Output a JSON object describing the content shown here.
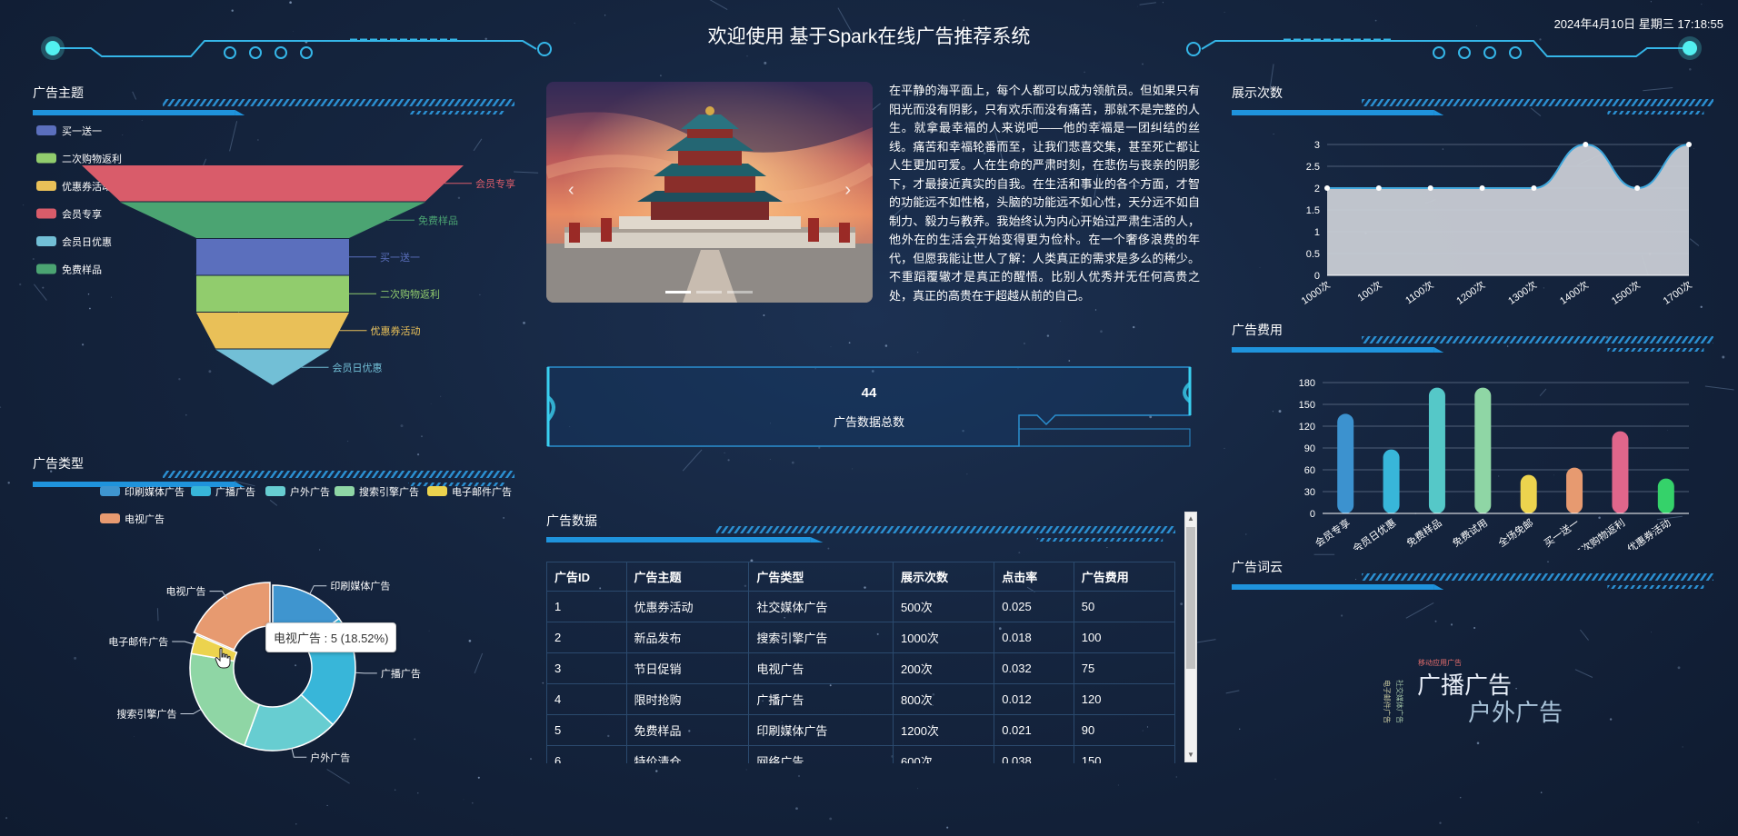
{
  "header": {
    "title": "欢迎使用 基于Spark在线广告推荐系统",
    "datetime": "2024年4月10日 星期三 17:18:55"
  },
  "panels": {
    "ad_theme": "广告主题",
    "ad_type": "广告类型",
    "impressions": "展示次数",
    "ad_cost": "广告费用",
    "ad_data": "广告数据",
    "word_cloud": "广告词云"
  },
  "carousel": {
    "prev_icon": "chevron-left-icon",
    "next_icon": "chevron-right-icon",
    "slide_count": 3,
    "active_index": 0
  },
  "article": {
    "text": "在平静的海平面上，每个人都可以成为领航员。但如果只有阳光而没有阴影，只有欢乐而没有痛苦，那就不是完整的人生。就拿最幸福的人来说吧——他的幸福是一团纠结的丝线。痛苦和幸福轮番而至，让我们悲喜交集，甚至死亡都让人生更加可爱。人在生命的严肃时刻，在悲伤与丧亲的阴影下，才最接近真实的自我。在生活和事业的各个方面，才智的功能远不如性格，头脑的功能远不如心性，天分远不如自制力、毅力与教养。我始终认为内心开始过严肃生活的人，他外在的生活会开始变得更为俭朴。在一个奢侈浪费的年代，但愿我能让世人了解：人类真正的需求是多么的稀少。不重蹈覆辙才是真正的醒悟。比别人优秀并无任何高贵之处，真正的高贵在于超越从前的自己。"
  },
  "stat": {
    "value": "44",
    "label": "广告数据总数"
  },
  "table": {
    "headers": [
      "广告ID",
      "广告主题",
      "广告类型",
      "展示次数",
      "点击率",
      "广告费用"
    ],
    "rows": [
      [
        "1",
        "优惠券活动",
        "社交媒体广告",
        "500次",
        "0.025",
        "50"
      ],
      [
        "2",
        "新品发布",
        "搜索引擎广告",
        "1000次",
        "0.018",
        "100"
      ],
      [
        "3",
        "节日促销",
        "电视广告",
        "200次",
        "0.032",
        "75"
      ],
      [
        "4",
        "限时抢购",
        "广播广告",
        "800次",
        "0.012",
        "120"
      ],
      [
        "5",
        "免费样品",
        "印刷媒体广告",
        "1200次",
        "0.021",
        "90"
      ],
      [
        "6",
        "特价清仓",
        "网络广告",
        "600次",
        "0.038",
        "150"
      ]
    ],
    "scroll_up_icon": "triangle-up-icon",
    "scroll_down_icon": "triangle-down-icon"
  },
  "pie_tooltip": "电视广告 : 5 (18.52%)",
  "word_cloud": {
    "words": [
      {
        "text": "广播广告",
        "color": "#e8eef8"
      },
      {
        "text": "户外广告",
        "color": "#a9c3d9"
      },
      {
        "text": "移动应用广告",
        "color": "#e06b6b"
      },
      {
        "text": "电子邮件广告",
        "color": "#c9c9a0"
      },
      {
        "text": "社交媒体广告",
        "color": "#9fc0a4"
      }
    ]
  },
  "chart_data": [
    {
      "type": "funnel",
      "title": "广告主题",
      "legend": [
        "买一送一",
        "二次购物返利",
        "优惠券活动",
        "会员专享",
        "会员日优惠",
        "免费样品"
      ],
      "legend_position": "top-left",
      "categories": [
        "会员专享",
        "免费样品",
        "买一送一",
        "二次购物返利",
        "优惠券活动",
        "会员日优惠"
      ],
      "values": [
        100,
        80,
        40,
        40,
        40,
        30
      ],
      "colors": [
        "#d95c6a",
        "#4ba472",
        "#5b6fbd",
        "#91cc6d",
        "#e9c058",
        "#72bfd6"
      ]
    },
    {
      "type": "pie",
      "title": "广告类型",
      "legend": [
        "印刷媒体广告",
        "广播广告",
        "户外广告",
        "搜索引擎广告",
        "电子邮件广告",
        "电视广告"
      ],
      "legend_position": "top",
      "categories": [
        "印刷媒体广告",
        "广播广告",
        "户外广告",
        "搜索引擎广告",
        "电子邮件广告",
        "电视广告"
      ],
      "values": [
        4,
        6,
        5,
        6,
        1,
        5
      ],
      "colors": [
        "#3f95cf",
        "#38b6d9",
        "#67cdd1",
        "#8fd6a5",
        "#ecd34e",
        "#e79a70"
      ],
      "donut": true
    },
    {
      "type": "area",
      "title": "展示次数",
      "categories": [
        "1000次",
        "100次",
        "1100次",
        "1200次",
        "1300次",
        "1400次",
        "1500次",
        "1700次"
      ],
      "values": [
        2,
        2,
        2,
        2,
        2,
        3,
        2,
        3
      ],
      "ylim": [
        0,
        3
      ],
      "yticks": [
        0,
        0.5,
        1,
        1.5,
        2,
        2.5,
        3
      ],
      "grid": true,
      "color": "#c8ccd4"
    },
    {
      "type": "bar",
      "title": "广告费用",
      "categories": [
        "会员专享",
        "会员日优惠",
        "免费样品",
        "免费试用",
        "全场免邮",
        "买一送一",
        "二次购物返利",
        "优惠券活动"
      ],
      "values": [
        137,
        88,
        173,
        173,
        53,
        63,
        113,
        48
      ],
      "ylim": [
        0,
        180
      ],
      "yticks": [
        0,
        30,
        60,
        90,
        120,
        150,
        180
      ],
      "grid": true,
      "colors": [
        "#3c92cf",
        "#38b6d9",
        "#55c8c8",
        "#8fd6a5",
        "#ecd34e",
        "#e79a70",
        "#e0668b",
        "#35d26a"
      ]
    }
  ]
}
